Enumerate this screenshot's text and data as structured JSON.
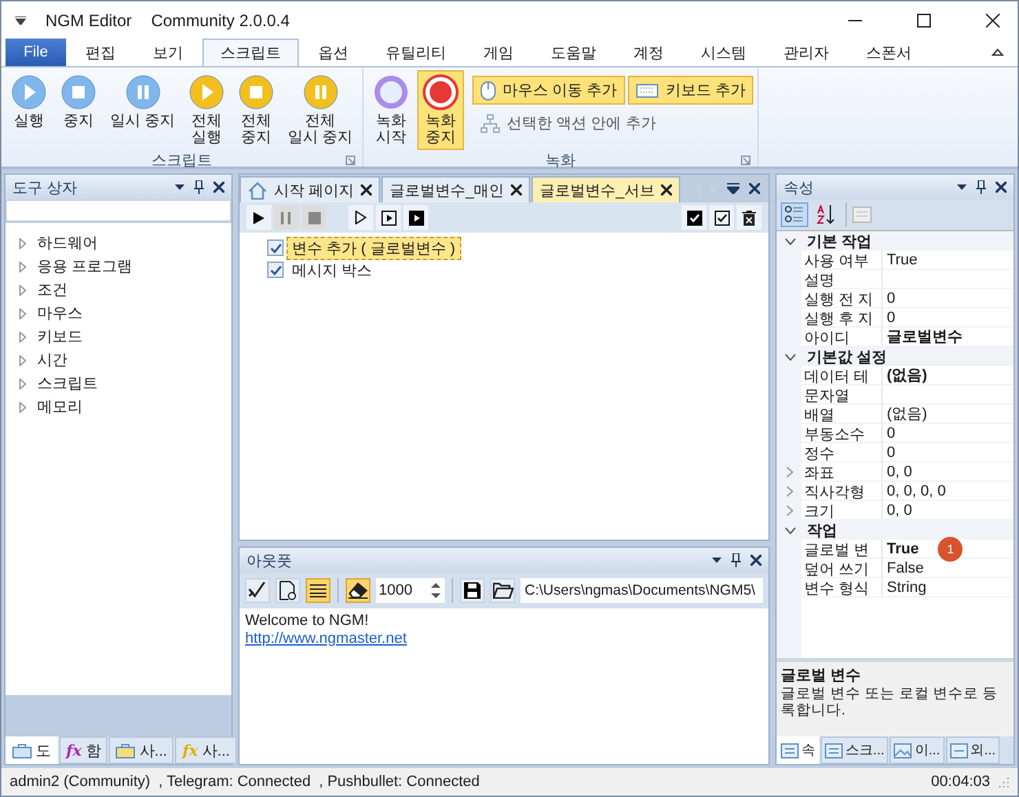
{
  "window": {
    "title": "NGM Editor",
    "edition": "Community 2.0.0.4"
  },
  "ribbon_tabs": [
    {
      "label": "File",
      "kind": "file",
      "selected": false
    },
    {
      "label": "편집",
      "kind": "tab",
      "selected": false
    },
    {
      "label": "보기",
      "kind": "tab",
      "selected": false
    },
    {
      "label": "스크립트",
      "kind": "tab",
      "selected": true
    },
    {
      "label": "옵션",
      "kind": "tab",
      "selected": false
    },
    {
      "label": "유틸리티",
      "kind": "tab",
      "selected": false
    },
    {
      "label": "게임",
      "kind": "tab",
      "selected": false
    },
    {
      "label": "도움말",
      "kind": "tab",
      "selected": false
    },
    {
      "label": "계정",
      "kind": "tab",
      "selected": false
    },
    {
      "label": "시스템",
      "kind": "tab",
      "selected": false
    },
    {
      "label": "관리자",
      "kind": "tab",
      "selected": false
    },
    {
      "label": "스폰서",
      "kind": "tab",
      "selected": false
    }
  ],
  "ribbon_groups": [
    {
      "title": "스크립트",
      "buttons": [
        {
          "label": "실행",
          "kind": "play",
          "color": "#7fb6ec",
          "on": false
        },
        {
          "label": "중지",
          "kind": "stop",
          "color": "#7fb6ec",
          "on": false
        },
        {
          "label": "일시 중지",
          "kind": "pause",
          "color": "#7fb6ec",
          "on": false
        },
        {
          "label": "전체\n실행",
          "kind": "play",
          "color": "#f2bf1e",
          "on": false
        },
        {
          "label": "전체\n중지",
          "kind": "stop",
          "color": "#f2bf1e",
          "on": false
        },
        {
          "label": "전체\n일시 중지",
          "kind": "pause",
          "color": "#f2bf1e",
          "on": false
        }
      ]
    },
    {
      "title": "녹화",
      "buttons": [
        {
          "label": "녹화\n시작",
          "kind": "record-start",
          "color": "#a98de8",
          "on": false
        },
        {
          "label": "녹화\n중지",
          "kind": "record-stop",
          "color": "#e53935",
          "on": true
        }
      ],
      "small_buttons": [
        {
          "label": "마우스 이동 추가",
          "kind": "mouse",
          "on": true,
          "disabled": false
        },
        {
          "label": "키보드 추가",
          "kind": "keyboard",
          "on": true,
          "disabled": false
        },
        {
          "label": "선택한 액션 안에 추가",
          "kind": "tree",
          "on": false,
          "disabled": true
        }
      ]
    }
  ],
  "toolbox": {
    "title": "도구 상자",
    "items": [
      {
        "label": "하드웨어"
      },
      {
        "label": "응용 프로그램"
      },
      {
        "label": "조건"
      },
      {
        "label": "마우스"
      },
      {
        "label": "키보드"
      },
      {
        "label": "시간"
      },
      {
        "label": "스크립트"
      },
      {
        "label": "메모리"
      }
    ],
    "bottom_tabs": [
      {
        "label": "도",
        "kind": "toolbox",
        "selected": true
      },
      {
        "label": "함",
        "kind": "fx",
        "icon": "fx",
        "selected": false
      },
      {
        "label": "사...",
        "kind": "toolbox-yellow",
        "selected": false
      },
      {
        "label": "사...",
        "kind": "fx-yellow",
        "icon": "fx",
        "selected": false
      }
    ]
  },
  "documents": {
    "tabs": [
      {
        "label": "시작 페이지",
        "kind": "home",
        "selected": false
      },
      {
        "label": "글로벌변수_매인",
        "kind": "doc",
        "selected": false
      },
      {
        "label": "글로벌변수_서브",
        "kind": "doc",
        "selected": true
      }
    ],
    "actions": [
      {
        "label": "변수 추가 ( 글로벌변수 )",
        "checked": true,
        "selected": true
      },
      {
        "label": "메시지 박스",
        "checked": true,
        "selected": false
      }
    ]
  },
  "output": {
    "title": "아웃풋",
    "wrap_on": true,
    "auto_clear_on": true,
    "max_lines": "1000",
    "path": "C:\\Users\\ngmas\\Documents\\NGM5\\",
    "lines": [
      {
        "text": "Welcome to NGM!",
        "kind": "text"
      },
      {
        "text": "http://www.ngmaster.net",
        "kind": "link"
      }
    ]
  },
  "properties": {
    "title": "속성",
    "view_buttons": [
      {
        "kind": "categorized",
        "selected": true
      },
      {
        "kind": "alphabetical",
        "selected": false
      }
    ],
    "categories": [
      {
        "name": "기본 작업",
        "expanded": true,
        "rows": [
          {
            "name": "사용 여부",
            "value": "True",
            "bold": false,
            "expandable": false
          },
          {
            "name": "설명",
            "value": "",
            "expandable": false
          },
          {
            "name": "실행 전 지",
            "value": "0",
            "bold": false,
            "expandable": false
          },
          {
            "name": "실행 후 지",
            "value": "0",
            "bold": false,
            "expandable": false
          },
          {
            "name": "아이디",
            "value": "글로벌변수",
            "bold": true,
            "expandable": false
          }
        ]
      },
      {
        "name": "기본값 설정",
        "expanded": true,
        "rows": [
          {
            "name": "데이터 테",
            "value": "(없음)",
            "bold": true,
            "expandable": false
          },
          {
            "name": "문자열",
            "value": "",
            "expandable": false
          },
          {
            "name": "배열",
            "value": "(없음)",
            "bold": false,
            "expandable": false
          },
          {
            "name": "부동소수",
            "value": "0",
            "bold": false,
            "expandable": false
          },
          {
            "name": "정수",
            "value": "0",
            "bold": false,
            "expandable": false
          },
          {
            "name": "좌표",
            "value": "0, 0",
            "bold": false,
            "expandable": true
          },
          {
            "name": "직사각형",
            "value": "0, 0, 0, 0",
            "bold": false,
            "expandable": true
          },
          {
            "name": "크기",
            "value": "0, 0",
            "bold": false,
            "expandable": true
          }
        ]
      },
      {
        "name": "작업",
        "expanded": true,
        "rows": [
          {
            "name": "글로벌 변",
            "value": "True",
            "bold": true,
            "expandable": false,
            "badge": "1"
          },
          {
            "name": "덮어 쓰기",
            "value": "False",
            "bold": false,
            "expandable": false
          },
          {
            "name": "변수 형식",
            "value": "String",
            "bold": false,
            "expandable": false
          }
        ]
      }
    ],
    "description_title": "글로벌 변수",
    "description": "글로벌 변수 또는 로컬 변수로 등록합니다.",
    "bottom_tabs": [
      {
        "label": "속",
        "kind": "props",
        "selected": true
      },
      {
        "label": "스크...",
        "kind": "props",
        "selected": false
      },
      {
        "label": "이...",
        "kind": "image",
        "selected": false
      },
      {
        "label": "외...",
        "kind": "api",
        "selected": false
      }
    ]
  },
  "status_bar": {
    "items": [
      "admin2 (Community)",
      ", Telegram: Connected",
      ", Pushbullet: Connected"
    ],
    "time": "00:04:03"
  }
}
